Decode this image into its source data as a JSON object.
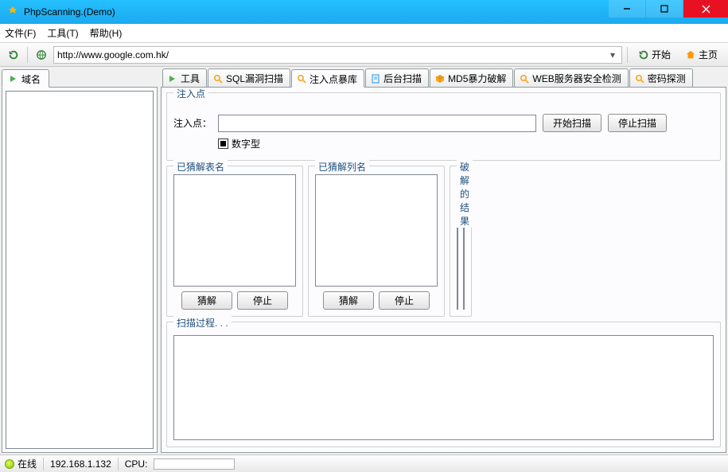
{
  "window": {
    "title": "PhpScanning.(Demo)"
  },
  "menubar": {
    "file": "文件(F)",
    "tools": "工具(T)",
    "help": "帮助(H)"
  },
  "addrbar": {
    "url": "http://www.google.com.hk/",
    "start": "开始",
    "home": "主页"
  },
  "left_tabs": {
    "domain": "域名"
  },
  "right_tabs": {
    "tools": "工具",
    "sqlscan": "SQL漏洞扫描",
    "injectdb": "注入点暴库",
    "backscan": "后台扫描",
    "md5": "MD5暴力破解",
    "websec": "WEB服务器安全检测",
    "pwprobe": "密码探测"
  },
  "inject": {
    "group_legend": "注入点",
    "label": "注入点：",
    "value": "",
    "start_scan": "开始扫描",
    "stop_scan": "停止扫描",
    "numeric_checkbox": "数字型"
  },
  "guess_tables": {
    "legend": "已猜解表名",
    "guess": "猜解",
    "stop": "停止"
  },
  "guess_cols": {
    "legend": "已猜解列名",
    "guess": "猜解",
    "stop": "停止"
  },
  "results": {
    "legend": "破解的结果"
  },
  "log": {
    "legend": "扫描过程. . ."
  },
  "status": {
    "online": "在线",
    "ip": "192.168.1.132",
    "cpu_label": "CPU:"
  }
}
